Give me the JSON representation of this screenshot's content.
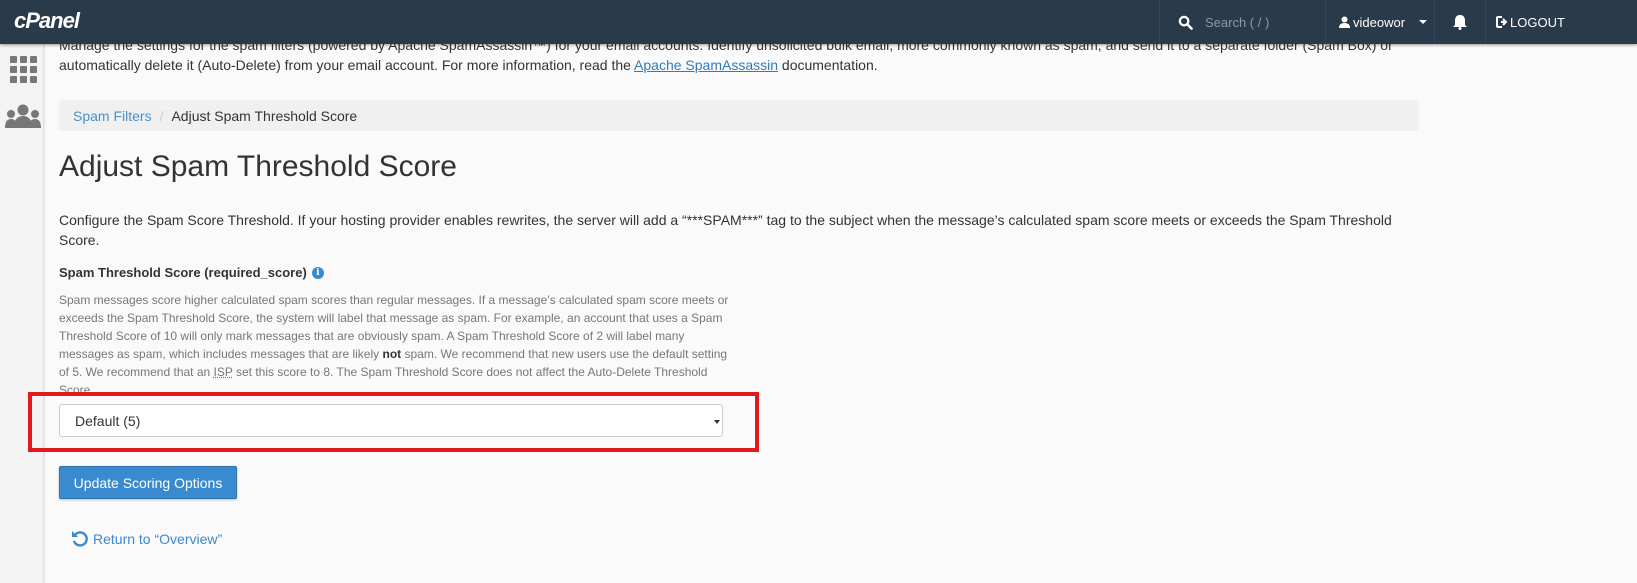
{
  "header": {
    "logo": "cPanel",
    "search_placeholder": "Search ( / )",
    "username": "videowor",
    "logout_label": "LOGOUT"
  },
  "sidebar": {
    "items": [
      {
        "icon": "grid-icon"
      },
      {
        "icon": "users-icon"
      }
    ]
  },
  "intro": {
    "text_before": "Manage the settings for the spam filters (powered by Apache SpamAssassin™) for your email accounts. Identify unsolicited bulk email, more commonly known as spam, and send it to a separate folder (Spam Box) or automatically delete it (Auto-Delete) from your email account. For more information, read the ",
    "link": "Apache SpamAssassin",
    "text_after": " documentation."
  },
  "breadcrumb": {
    "parent": "Spam Filters",
    "separator": "/",
    "current": "Adjust Spam Threshold Score"
  },
  "page_title": "Adjust Spam Threshold Score",
  "description": "Configure the Spam Score Threshold. If your hosting provider enables rewrites, the server will add a “***SPAM***” tag to the subject when the message’s calculated spam score meets or exceeds the Spam Threshold Score.",
  "field": {
    "label": "Spam Threshold Score (required_score)",
    "help_part1": "Spam messages score higher calculated spam scores than regular messages. If a message’s calculated spam score meets or exceeds the Spam Threshold Score, the system will label that message as spam. For example, an account that uses a Spam Threshold Score of 10 will only mark messages that are obviously spam. A Spam Threshold Score of 2 will label many messages as spam, which includes messages that are likely ",
    "help_bold": "not",
    "help_part2": " spam. We recommend that new users use the default setting of 5. We recommend that an ",
    "help_abbr": "ISP",
    "help_part3": " set this score to 8. The Spam Threshold Score does not affect the Auto-Delete Threshold Score.",
    "selected_value": "Default (5)"
  },
  "update_button": "Update Scoring Options",
  "return_link": "Return to “Overview”",
  "colors": {
    "header": "#293a4a",
    "accent": "#3a8ad0",
    "highlight": "#e01a1a"
  }
}
